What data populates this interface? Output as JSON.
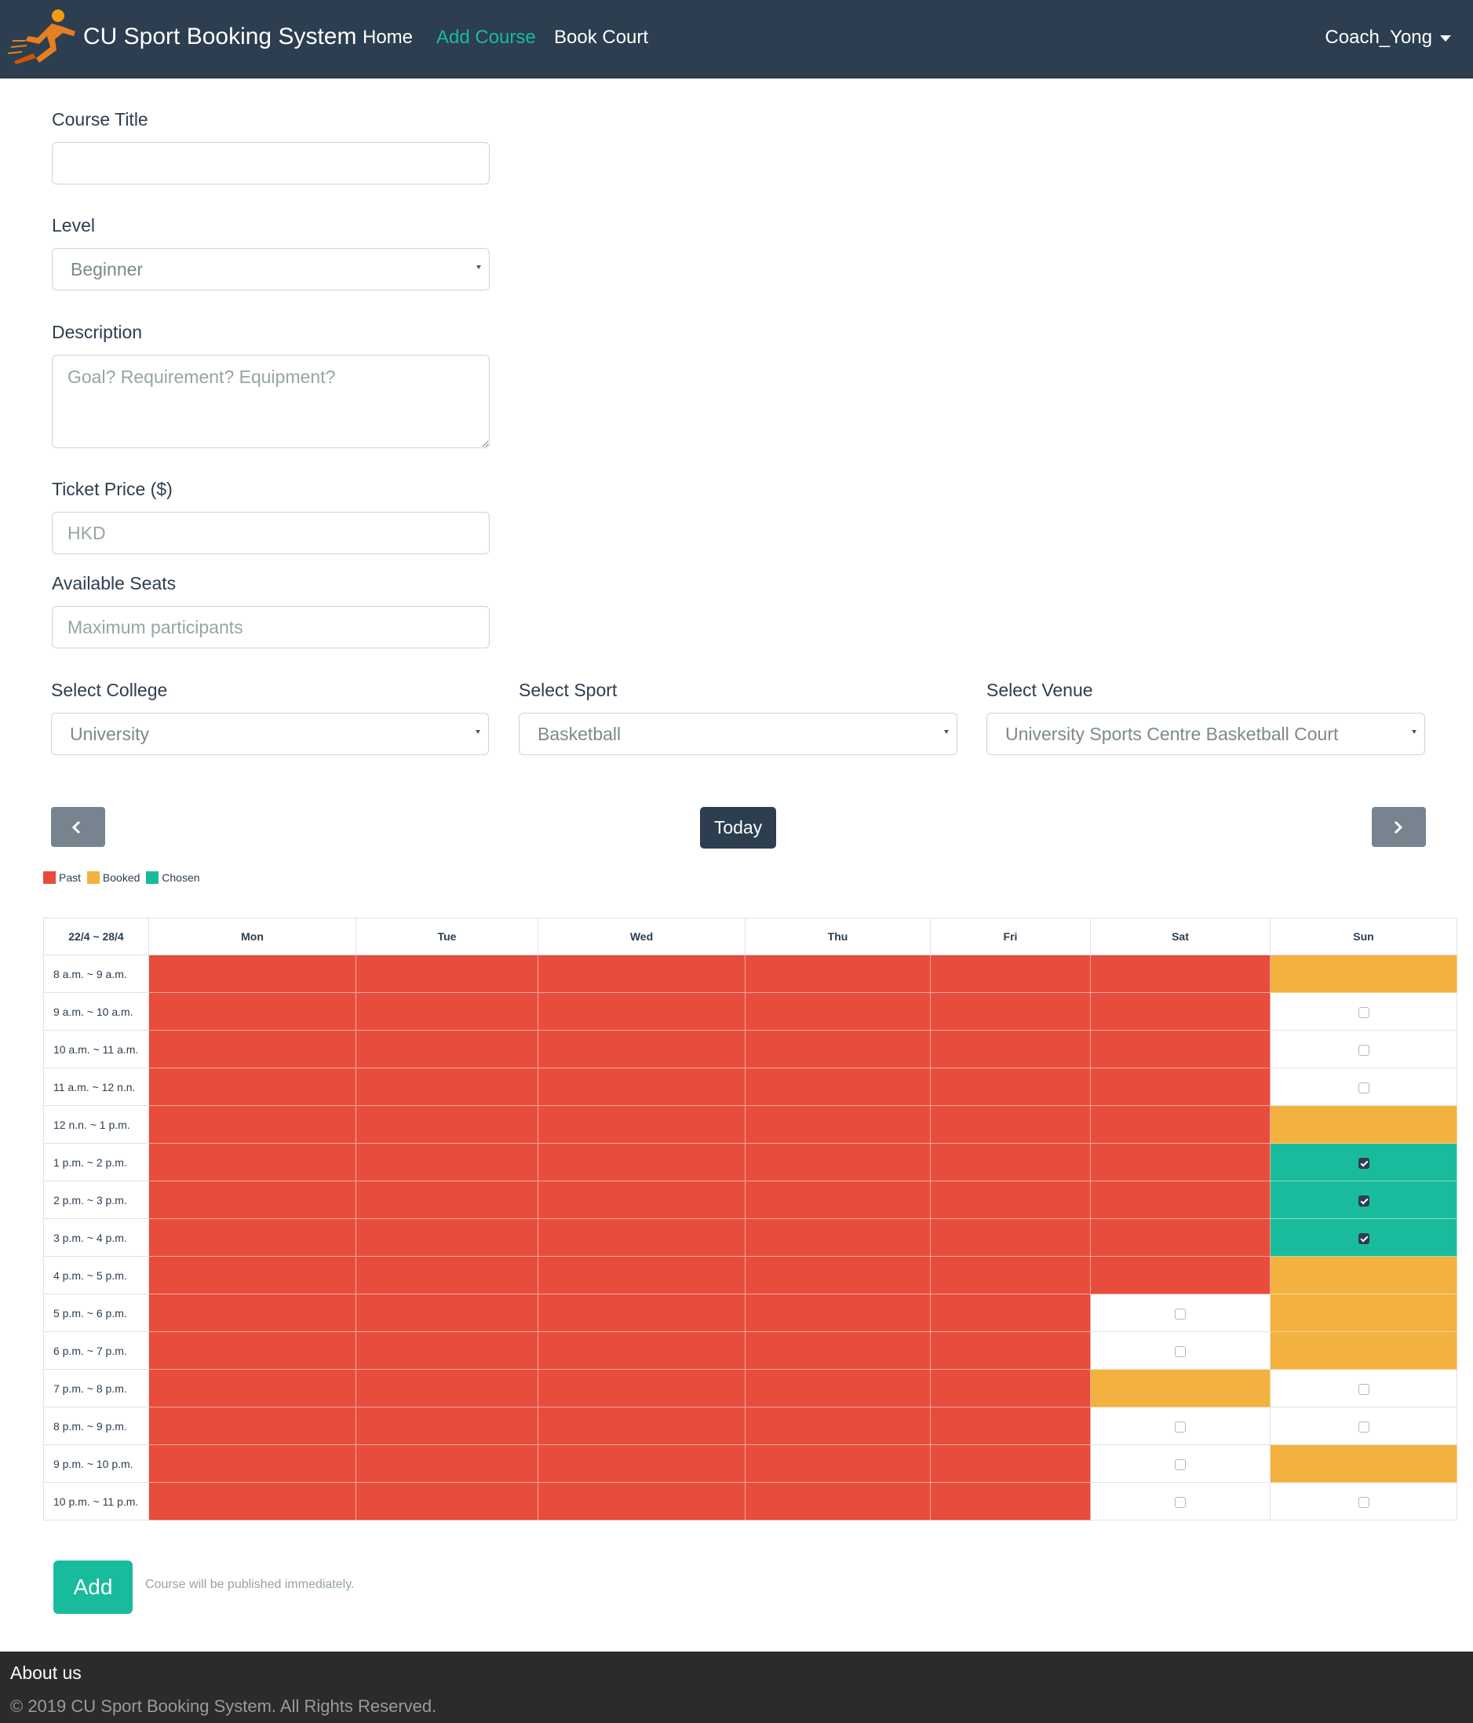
{
  "navbar": {
    "brand": "CU Sport Booking System",
    "links": [
      "Home",
      "Add Course",
      "Book Court"
    ],
    "active_link": "Add Course",
    "user": "Coach_Yong",
    "colors": {
      "bar": "#2c3e50",
      "active": "#18bc9c"
    }
  },
  "form": {
    "course_title": {
      "label": "Course Title",
      "value": "",
      "placeholder": ""
    },
    "level": {
      "label": "Level",
      "value": "Beginner"
    },
    "description": {
      "label": "Description",
      "placeholder": "Goal? Requirement? Equipment?"
    },
    "ticket_price": {
      "label": "Ticket Price ($)",
      "placeholder": "HKD"
    },
    "available_seats": {
      "label": "Available Seats",
      "placeholder": "Maximum participants"
    },
    "college": {
      "label": "Select College",
      "value": "University"
    },
    "sport": {
      "label": "Select Sport",
      "value": "Basketball"
    },
    "venue": {
      "label": "Select Venue",
      "value": "University Sports Centre Basketball Court"
    }
  },
  "calendar": {
    "today_label": "Today",
    "prev_icon": "chevron-left-icon",
    "next_icon": "chevron-right-icon",
    "legend": [
      {
        "label": "Past",
        "color": "#e74c3c"
      },
      {
        "label": "Booked",
        "color": "#f3b240"
      },
      {
        "label": "Chosen",
        "color": "#18bc9c"
      }
    ],
    "week_label": "22/4 ~ 28/4",
    "days": [
      "Mon",
      "Tue",
      "Wed",
      "Thu",
      "Fri",
      "Sat",
      "Sun"
    ],
    "slots": [
      {
        "time": "8 a.m. ~ 9 a.m.",
        "cells": [
          "past",
          "past",
          "past",
          "past",
          "past",
          "past",
          "booked"
        ]
      },
      {
        "time": "9 a.m. ~ 10 a.m.",
        "cells": [
          "past",
          "past",
          "past",
          "past",
          "past",
          "past",
          "free"
        ]
      },
      {
        "time": "10 a.m. ~ 11 a.m.",
        "cells": [
          "past",
          "past",
          "past",
          "past",
          "past",
          "past",
          "free"
        ]
      },
      {
        "time": "11 a.m. ~ 12 n.n.",
        "cells": [
          "past",
          "past",
          "past",
          "past",
          "past",
          "past",
          "free"
        ]
      },
      {
        "time": "12 n.n. ~ 1 p.m.",
        "cells": [
          "past",
          "past",
          "past",
          "past",
          "past",
          "past",
          "booked"
        ]
      },
      {
        "time": "1 p.m. ~ 2 p.m.",
        "cells": [
          "past",
          "past",
          "past",
          "past",
          "past",
          "past",
          "chosen"
        ]
      },
      {
        "time": "2 p.m. ~ 3 p.m.",
        "cells": [
          "past",
          "past",
          "past",
          "past",
          "past",
          "past",
          "chosen"
        ]
      },
      {
        "time": "3 p.m. ~ 4 p.m.",
        "cells": [
          "past",
          "past",
          "past",
          "past",
          "past",
          "past",
          "chosen"
        ]
      },
      {
        "time": "4 p.m. ~ 5 p.m.",
        "cells": [
          "past",
          "past",
          "past",
          "past",
          "past",
          "past",
          "booked"
        ]
      },
      {
        "time": "5 p.m. ~ 6 p.m.",
        "cells": [
          "past",
          "past",
          "past",
          "past",
          "past",
          "free",
          "booked"
        ]
      },
      {
        "time": "6 p.m. ~ 7 p.m.",
        "cells": [
          "past",
          "past",
          "past",
          "past",
          "past",
          "free",
          "booked"
        ]
      },
      {
        "time": "7 p.m. ~ 8 p.m.",
        "cells": [
          "past",
          "past",
          "past",
          "past",
          "past",
          "booked",
          "free"
        ]
      },
      {
        "time": "8 p.m. ~ 9 p.m.",
        "cells": [
          "past",
          "past",
          "past",
          "past",
          "past",
          "free",
          "free"
        ]
      },
      {
        "time": "9 p.m. ~ 10 p.m.",
        "cells": [
          "past",
          "past",
          "past",
          "past",
          "past",
          "free",
          "booked"
        ]
      },
      {
        "time": "10 p.m. ~ 11 p.m.",
        "cells": [
          "past",
          "past",
          "past",
          "past",
          "past",
          "free",
          "free"
        ]
      }
    ]
  },
  "submit": {
    "label": "Add",
    "hint": "Course will be published immediately."
  },
  "footer": {
    "about": "About us",
    "copyright": "© 2019 CU Sport Booking System. All Rights Reserved."
  }
}
